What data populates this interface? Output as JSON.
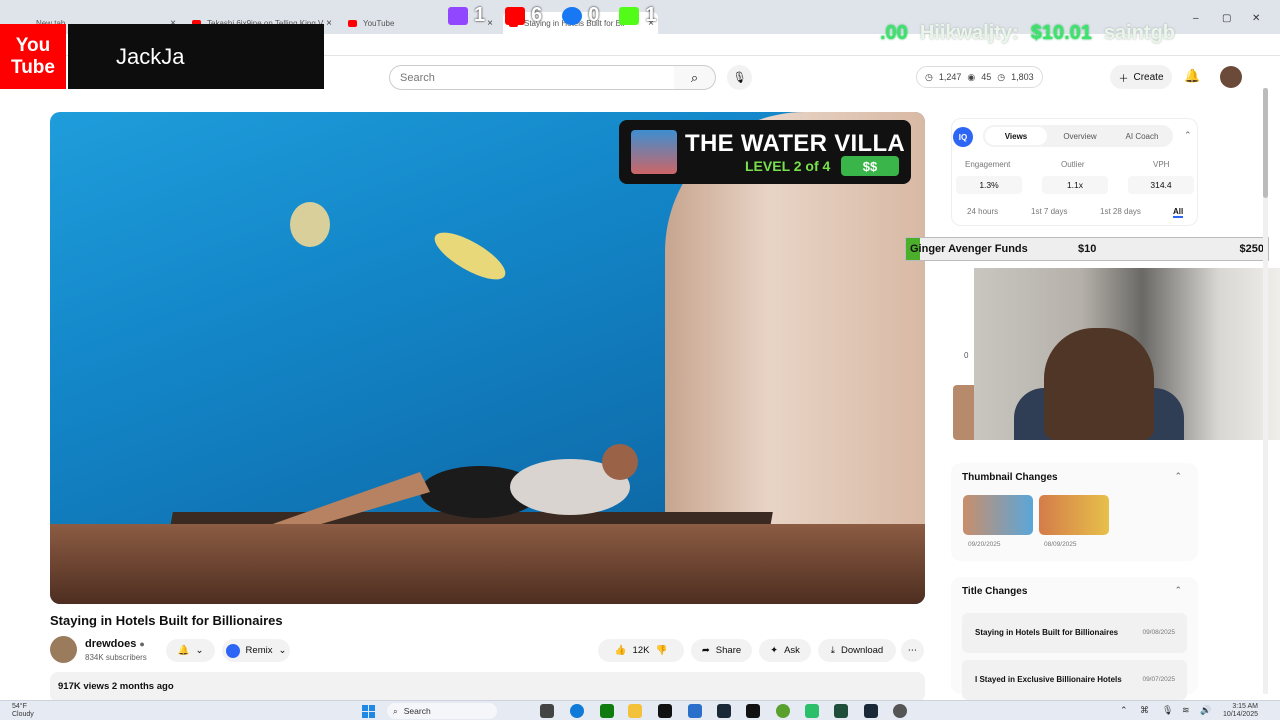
{
  "browser": {
    "tabs": [
      {
        "label": "New tab"
      },
      {
        "label": "Tekashi 6ix9ine on Telling King V"
      },
      {
        "label": "YouTube"
      },
      {
        "label": "Staying in Hotels Built for Bil"
      }
    ],
    "window_controls": {
      "minimize": "–",
      "restore": "▢",
      "close": "✕"
    }
  },
  "stream_overlay": {
    "yt_logo_line1": "You",
    "yt_logo_line2": "Tube",
    "streamer_name": "JackJa",
    "counts": [
      {
        "platform": "twitch",
        "value": "1",
        "color": "#9146ff"
      },
      {
        "platform": "youtube",
        "value": "6",
        "color": "#ff0000"
      },
      {
        "platform": "facebook",
        "value": "0",
        "color": "#1877f2"
      },
      {
        "platform": "kick",
        "value": "1",
        "color": "#53fc18"
      }
    ],
    "ticker_amount_left": ".00",
    "ticker_name": "Hiikwaljty:",
    "ticker_amount": "$10.01",
    "ticker_next": "saintgb",
    "goal": {
      "label": "Ginger Avenger Funds",
      "current": "$10",
      "target": "$250",
      "fraction": 0.04
    }
  },
  "masthead": {
    "search_placeholder": "Search",
    "stats": {
      "views": "1,247",
      "eyes": "45",
      "watch": "1,803"
    },
    "create_label": "Create"
  },
  "video": {
    "title": "Staying in Hotels Built for Billionaires",
    "thumb_badge_title": "THE WATER VILLA",
    "thumb_badge_level": "LEVEL 2 of 4",
    "thumb_badge_money": "$$",
    "channel_name": "drewdoes",
    "subscribers": "834K subscribers",
    "remix_label": "Remix",
    "likes": "12K",
    "share_label": "Share",
    "ask_label": "Ask",
    "download_label": "Download",
    "views_line": "917K views  2 months ago"
  },
  "extension": {
    "logo": "IQ",
    "tabs": [
      "Views",
      "Overview",
      "AI Coach"
    ],
    "metrics": [
      {
        "label": "Engagement",
        "value": "1.3%"
      },
      {
        "label": "Outlier",
        "value": "1.1x"
      },
      {
        "label": "VPH",
        "value": "314.4"
      }
    ],
    "ranges": [
      "24 hours",
      "1st 7 days",
      "1st 28 days",
      "All"
    ],
    "side_numbers": {
      "left_value": "0"
    },
    "thumbnail_changes": {
      "title": "Thumbnail Changes",
      "items": [
        {
          "date": "09/20/2025"
        },
        {
          "date": "08/09/2025"
        }
      ]
    },
    "title_changes": {
      "title": "Title Changes",
      "items": [
        {
          "title": "Staying in Hotels Built for Billionaires",
          "date": "09/08/2025"
        },
        {
          "title": "I Stayed in Exclusive Billionaire Hotels",
          "date": "09/07/2025"
        }
      ]
    }
  },
  "taskbar": {
    "weather_temp": "54°F",
    "weather_desc": "Cloudy",
    "search_label": "Search",
    "time": "3:15 AM",
    "date": "10/14/2025"
  }
}
